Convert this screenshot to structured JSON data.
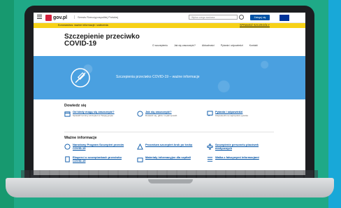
{
  "site": {
    "logo_text": "gov.pl",
    "site_name": "Serwis Rzeczypospolitej Polskiej",
    "search_placeholder": "Wpisz czego szukasz",
    "login_label": "Zaloguj się"
  },
  "alert": {
    "text": "Koronawirus: ważne informacje i zalecenia",
    "link": "SPRAWDŹ SZCZEGÓŁY"
  },
  "page": {
    "title": "Szczepienie przeciwko COVID-19",
    "nav": [
      "O szczepieniu",
      "Jak się zaszczepić?",
      "Aktualności",
      "Pytania i odpowiedzi",
      "Kontakt"
    ]
  },
  "hero": {
    "text": "Szczepienia przeciwko COVID-19 – ważne informacje"
  },
  "section1": {
    "title": "Dowiedz się",
    "cards": [
      {
        "title": "Od kiedy mogę się zaszczepić?",
        "desc": "Sprawdź terminy szczepień w Twojej grupie"
      },
      {
        "title": "Jak się zaszczepić?",
        "desc": "Dowiedz się, gdzie i w jaki sposób"
      },
      {
        "title": "Pytania i odpowiedzi",
        "desc": "Odpowiedzi na najczęstsze pytania"
      }
    ]
  },
  "section2": {
    "title": "Ważne informacje",
    "cards": [
      {
        "title": "Narodowy Program Szczepień przeciw COVID-19"
      },
      {
        "title": "Procedura szczepień krok po kroku"
      },
      {
        "title": "Szczepienie personelu placówek medycznych"
      },
      {
        "title": "Eksperci o szczepionkach przeciwko COVID-19"
      },
      {
        "title": "Materiały informacyjne dla szpitali"
      },
      {
        "title": "Walka z fałszywymi informacjami"
      }
    ]
  },
  "colors": {
    "background": "#1fa987",
    "hero": "#4aa0e0",
    "alert": "#f7d117",
    "link": "#0052a5",
    "brand": "#d4213d"
  }
}
